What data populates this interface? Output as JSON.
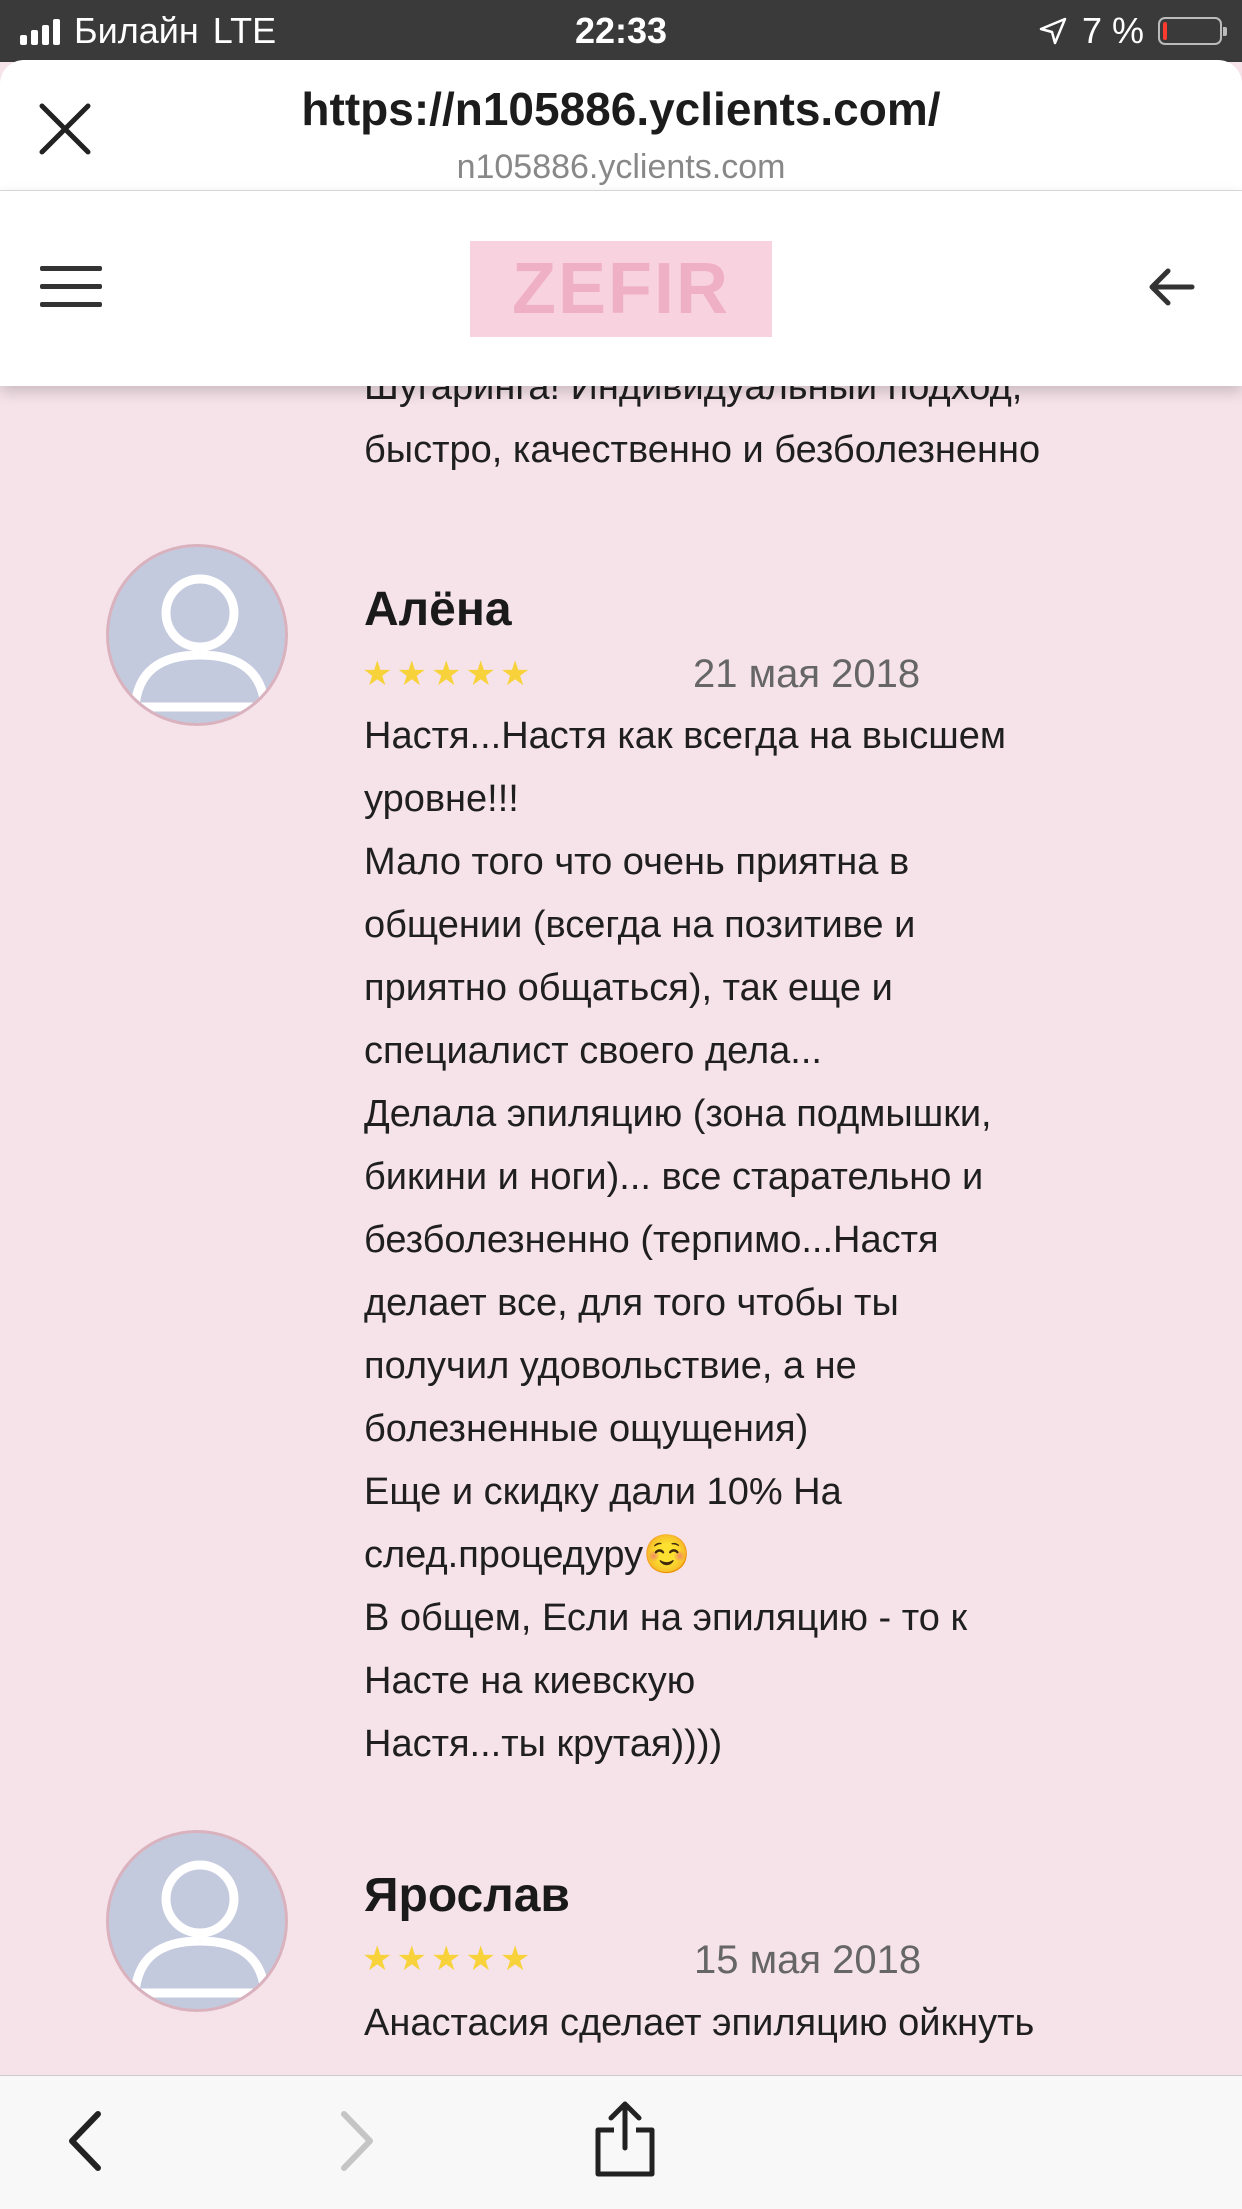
{
  "status_bar": {
    "carrier": "Билайн",
    "network": "LTE",
    "time": "22:33",
    "battery": "7 %",
    "battery_level": 0.07,
    "battery_color": "#ff3b30"
  },
  "browser": {
    "url": "https://n105886.yclients.com/",
    "domain": "n105886.yclients.com",
    "close_icon": "close-icon",
    "back_icon": "back-chevron-icon",
    "forward_icon": "forward-chevron-icon",
    "share_icon": "share-icon"
  },
  "header": {
    "logo": "ZEFIR",
    "menu_icon": "hamburger-icon",
    "back_icon": "arrow-left-icon",
    "accent": "#f8d2de"
  },
  "reviews": {
    "partial_text": "Шугаринга! Индивидуальный подход,\nбыстро, качественно и безболезненно",
    "items": [
      {
        "author": "Алёна",
        "stars": "★★★★★",
        "rating": 5,
        "date": "21 мая 2018",
        "text": "Настя...Настя как всегда на высшем\nуровне!!!\nМало того что очень приятна в\nобщении (всегда на позитиве и\nприятно общаться), так еще и\nспециалист своего дела...\nДелала эпиляцию (зона подмышки,\nбикини и ноги)... все старательно и\nбезболезненно (терпимо...Настя\nделает все, для того чтобы ты\nполучил удовольствие, а не\nболезненные ощущения)\nЕще и скидку дали 10% На\nслед.процедуру☺️\nВ общем, Если на эпиляцию - то к\nНасте на киевскую\nНастя...ты крутая))))"
      },
      {
        "author": "Ярослав",
        "stars": "★★★★★",
        "rating": 5,
        "date": "15 мая 2018",
        "text": "Анастасия сделает эпиляцию ойкнуть"
      }
    ]
  }
}
